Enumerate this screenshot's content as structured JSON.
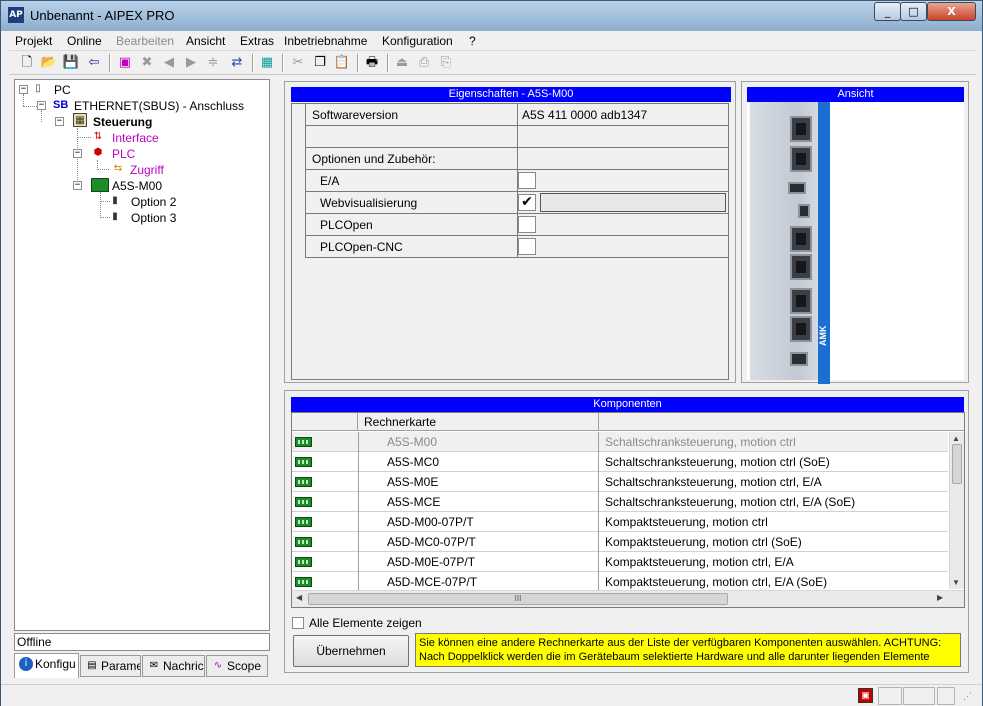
{
  "window": {
    "title": "Unbenannt - AIPEX PRO",
    "app_icon": "AP",
    "minimize": "_",
    "maximize": "□",
    "close": "X"
  },
  "menu": [
    "Projekt",
    "Online",
    "Bearbeiten",
    "Ansicht",
    "Extras",
    "Inbetriebnahme",
    "Konfiguration",
    "?"
  ],
  "tree": {
    "pc": "PC",
    "ethernet_tag": "SB",
    "ethernet": "ETHERNET(SBUS) - Anschluss",
    "steuerung": "Steuerung",
    "interface": "Interface",
    "plc": "PLC",
    "zugriff": "Zugriff",
    "a5s": "A5S-M00",
    "option2": "Option 2",
    "option3": "Option 3"
  },
  "status_left": "Offline",
  "tabs": [
    "Konfigu",
    "Parame",
    "Nachric",
    "Scope"
  ],
  "properties": {
    "header": "Eigenschaften - A5S-M00",
    "software_label": "Softwareversion",
    "software_value": "A5S 411 0000 adb1347",
    "options_label": "Optionen und Zubehör:",
    "options": [
      {
        "label": "E/A",
        "checked": false
      },
      {
        "label": "Webvisualisierung",
        "checked": true
      },
      {
        "label": "PLCOpen",
        "checked": false
      },
      {
        "label": "PLCOpen-CNC",
        "checked": false
      }
    ],
    "check_mark": "✔"
  },
  "view": {
    "header": "Ansicht",
    "brand": "AMK"
  },
  "components": {
    "header": "Komponenten",
    "column": "Rechnerkarte",
    "rows": [
      {
        "name": "A5S-M00",
        "desc": "Schaltschranksteuerung, motion ctrl"
      },
      {
        "name": "A5S-MC0",
        "desc": "Schaltschranksteuerung, motion ctrl (SoE)"
      },
      {
        "name": "A5S-M0E",
        "desc": "Schaltschranksteuerung, motion ctrl, E/A"
      },
      {
        "name": "A5S-MCE",
        "desc": "Schaltschranksteuerung, motion ctrl, E/A (SoE)"
      },
      {
        "name": "A5D-M00-07P/T",
        "desc": "Kompaktsteuerung, motion ctrl"
      },
      {
        "name": "A5D-MC0-07P/T",
        "desc": "Kompaktsteuerung, motion ctrl (SoE)"
      },
      {
        "name": "A5D-M0E-07P/T",
        "desc": "Kompaktsteuerung, motion ctrl, E/A"
      },
      {
        "name": "A5D-MCE-07P/T",
        "desc": "Kompaktsteuerung, motion ctrl, E/A (SoE)"
      }
    ],
    "scroll_thumb": "III",
    "show_all": "Alle Elemente zeigen",
    "apply_button": "Übernehmen",
    "hint_line1": "Sie können eine andere Rechnerkarte aus der Liste der verfügbaren Komponenten auswählen. ACHTUNG:",
    "hint_line2": "Nach Doppelklick werden die im Gerätebaum selektierte Hardware und alle darunter liegenden Elemente"
  },
  "colors": {
    "header_blue": "#0000ff",
    "plc_magenta": "#c000c0",
    "hint_yellow": "#ffff00"
  }
}
